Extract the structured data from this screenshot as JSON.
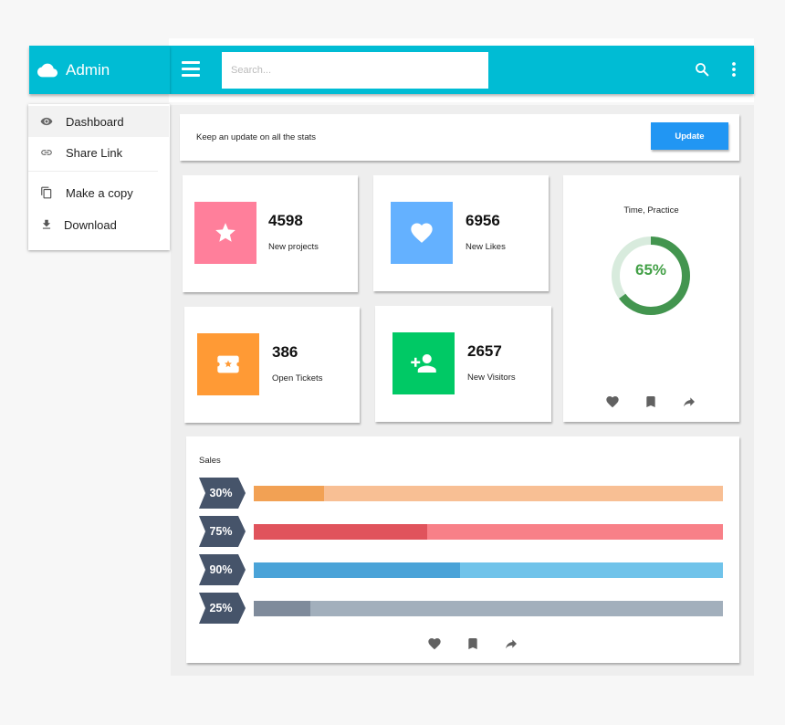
{
  "brand": {
    "title": "Admin",
    "icon": "cloud-icon"
  },
  "topbar": {
    "menu_icon": "hamburger-menu-icon",
    "search_placeholder": "Search...",
    "search_value": "",
    "search_icon": "search-icon",
    "more_icon": "more-vert-icon"
  },
  "sidebar": {
    "items": [
      {
        "label": "Dashboard",
        "icon": "eye-icon",
        "active": true
      },
      {
        "label": "Share Link",
        "icon": "link-icon",
        "active": false
      },
      {
        "label": "Make a copy",
        "icon": "copy-icon",
        "active": false
      },
      {
        "label": "Download",
        "icon": "download-icon",
        "active": false
      }
    ]
  },
  "update_bar": {
    "text": "Keep an update on all the stats",
    "button_label": "Update"
  },
  "stats": [
    {
      "value": "4598",
      "label": "New projects",
      "icon": "star-icon",
      "color": "#ff7f9b"
    },
    {
      "value": "6956",
      "label": "New Likes",
      "icon": "heart-icon",
      "color": "#64b1ff"
    },
    {
      "value": "386",
      "label": "Open Tickets",
      "icon": "ticket-icon",
      "color": "#ff9a35"
    },
    {
      "value": "2657",
      "label": "New Visitors",
      "icon": "person-add-icon",
      "color": "#00c965"
    }
  ],
  "time_card": {
    "title": "Time, Practice",
    "progress_percent": 65,
    "progress_label": "65%",
    "ring_color": "#43954f",
    "ring_track_color": "#d8ebdd",
    "actions": [
      "heart-icon",
      "bookmark-icon",
      "share-icon"
    ]
  },
  "sales": {
    "title": "Sales",
    "actions": [
      "heart-icon",
      "bookmark-icon",
      "share-icon"
    ],
    "bars": [
      {
        "label": "30%",
        "value": 30,
        "fill_fraction": 0.15,
        "fill_color": "#f2a154",
        "track_color": "#f8bf94"
      },
      {
        "label": "75%",
        "value": 75,
        "fill_fraction": 0.37,
        "fill_color": "#e0535c",
        "track_color": "#f88088"
      },
      {
        "label": "90%",
        "value": 90,
        "fill_fraction": 0.44,
        "fill_color": "#4aa3d8",
        "track_color": "#70c3ea"
      },
      {
        "label": "25%",
        "value": 25,
        "fill_fraction": 0.12,
        "fill_color": "#7f8b9b",
        "track_color": "#a2afbc"
      }
    ],
    "chevron_color": "#46546a"
  }
}
